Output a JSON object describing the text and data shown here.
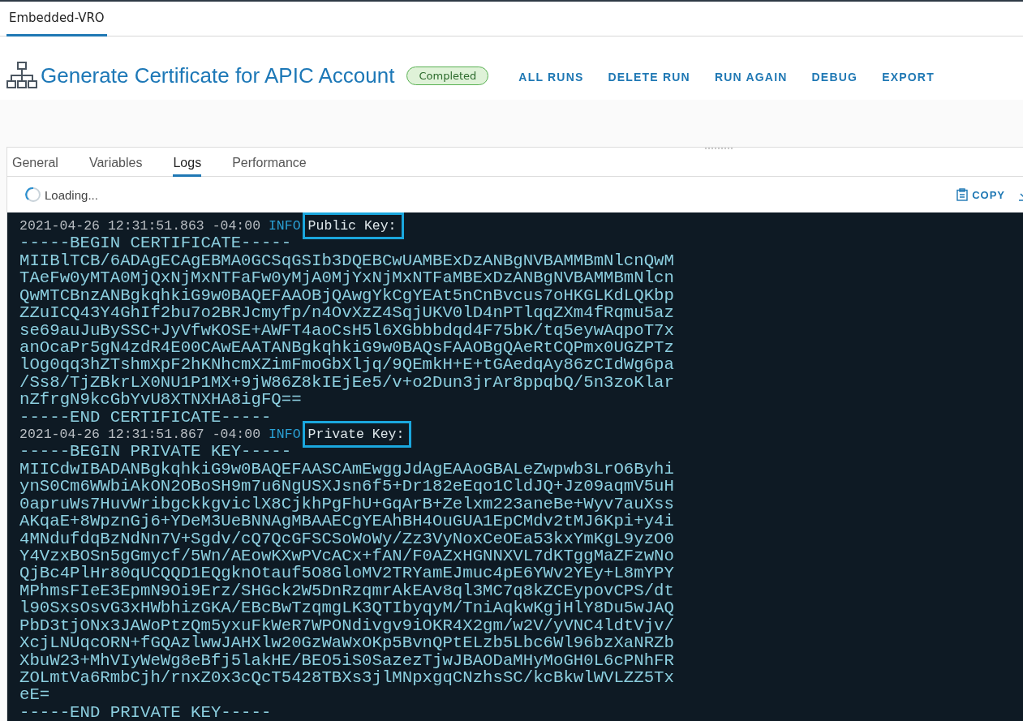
{
  "app_tabs": [
    {
      "label": "Embedded-VRO",
      "selected": true
    }
  ],
  "header": {
    "title": "Generate Certificate for APIC Account",
    "status": "Completed",
    "actions": [
      "ALL RUNS",
      "DELETE RUN",
      "RUN AGAIN",
      "DEBUG",
      "EXPORT"
    ]
  },
  "panel": {
    "tabs": [
      {
        "label": "General",
        "selected": false
      },
      {
        "label": "Variables",
        "selected": false
      },
      {
        "label": "Logs",
        "selected": true
      },
      {
        "label": "Performance",
        "selected": false
      }
    ],
    "toolbar": {
      "loading_text": "Loading...",
      "copy_label": "COPY"
    },
    "log": {
      "lines": [
        {
          "kind": "entry",
          "timestamp": "2021-04-26 12:31:51.863 -04:00",
          "level": "INFO",
          "message": "Public Key:",
          "highlighted": true
        },
        {
          "kind": "text",
          "text": "-----BEGIN CERTIFICATE-----"
        },
        {
          "kind": "text",
          "text": "MIIBlTCB/6ADAgECAgEBMA0GCSqGSIb3DQEBCwUAMBExDzANBgNVBAMMBmNlcnQwM"
        },
        {
          "kind": "text",
          "text": "TAeFw0yMTA0MjQxNjMxNTFaFw0yMjA0MjYxNjMxNTFaMBExDzANBgNVBAMMBmNlcn"
        },
        {
          "kind": "text",
          "text": "QwMTCBnzANBgkqhkiG9w0BAQEFAAOBjQAwgYkCgYEAt5nCnBvcus7oHKGLKdLQKbp"
        },
        {
          "kind": "text",
          "text": "ZZuICQ43Y4GhIf2bu7o2BRJcmyfp/n4OvXzZ4SqjUKV0lD4nPTlqqZXm4fRqmu5az"
        },
        {
          "kind": "text",
          "text": "se69auJuBySSC+JyVfwKOSE+AWFT4aoCsH5l6XGbbbdqd4F75bK/tq5eywAqpoT7x"
        },
        {
          "kind": "text",
          "text": "anOcaPr5gN4zdR4E00CAwEAATANBgkqhkiG9w0BAQsFAAOBgQAeRtCQPmx0UGZPTz"
        },
        {
          "kind": "text",
          "text": "lOg0qq3hZTshmXpF2hKNhcmXZimFmoGbXljq/9QEmkH+E+tGAedqAy86zCIdWg6pa"
        },
        {
          "kind": "text",
          "text": "/Ss8/TjZBkrLX0NU1P1MX+9jW86Z8kIEjEe5/v+o2Dun3jrAr8ppqbQ/5n3zoKlar"
        },
        {
          "kind": "text",
          "text": "nZfrgN9kcGbYvU8XTNXHA8igFQ=="
        },
        {
          "kind": "text",
          "text": "-----END CERTIFICATE-----"
        },
        {
          "kind": "entry",
          "timestamp": "2021-04-26 12:31:51.867 -04:00",
          "level": "INFO",
          "message": "Private Key:",
          "highlighted": true
        },
        {
          "kind": "text",
          "text": "-----BEGIN PRIVATE KEY-----"
        },
        {
          "kind": "text",
          "text": "MIICdwIBADANBgkqhkiG9w0BAQEFAASCAmEwggJdAgEAAoGBALeZwpwb3LrO6Byhi"
        },
        {
          "kind": "text",
          "text": "ynS0Cm6WWbiAkON2OBoSH9m7u6NgUSXJsn6f5+Dr182eEqo1CldJQ+Jz09aqmV5uH"
        },
        {
          "kind": "text",
          "text": "0apruWs7HuvWribgckkgviclX8CjkhPgFhU+GqArB+Zelxm223aneBe+Wyv7auXss"
        },
        {
          "kind": "text",
          "text": "AKqaE+8WpznGj6+YDeM3UeBNNAgMBAAECgYEAhBH4OuGUA1EpCMdv2tMJ6Kpi+y4i"
        },
        {
          "kind": "text",
          "text": "4MNdufdqBzNdNn7V+Sgdv/cQ7QcGFSCSoWoWy/Zz3VyNoxCeOEa53kxYmKgL9yzO0"
        },
        {
          "kind": "text",
          "text": "Y4VzxBOSn5gGmycf/5Wn/AEowKXwPVcACx+fAN/F0AZxHGNNXVL7dKTggMaZFzwNo"
        },
        {
          "kind": "text",
          "text": "QjBc4PlHr80qUCQQD1EQgknOtauf5O8GloMV2TRYamEJmuc4pE6YWv2YEy+L8mYPY"
        },
        {
          "kind": "text",
          "text": "MPhmsFIeE3EpmN9Oi9Erz/SHGck2W5DnRzqmrAkEAv8ql3MC7q8kZCEypovCPS/dt"
        },
        {
          "kind": "text",
          "text": "l90SxsOsvG3xHWbhizGKA/EBcBwTzqmgLK3QTIbyqyM/TniAqkwKgjHlY8Du5wJAQ"
        },
        {
          "kind": "text",
          "text": "PbD3tjONx3JAWoPtzQm5yxuFkWeR7WPONdivgv9iOKR4X2gm/w2V/yVNC4ldtVjv/"
        },
        {
          "kind": "text",
          "text": "XcjLNUqcORN+fGQAzlwwJAHXlw20GzWaWxOKp5BvnQPtELzb5Lbc6Wl96bzXaNRZb"
        },
        {
          "kind": "text",
          "text": "XbuW23+MhVIyWeWg8eBfj5lakHE/BEO5iS0SazezTjwJBAODaMHyMoGH0L6cPNhFR"
        },
        {
          "kind": "text",
          "text": "ZOLmtVa6RmbCjh/rnxZ0x3cQcT5428TBXs3jlMNpxgqCNzhsSC/kcBkwlWVLZZ5Tx"
        },
        {
          "kind": "text",
          "text": "eE="
        },
        {
          "kind": "text",
          "text": "-----END PRIVATE KEY-----"
        }
      ]
    }
  }
}
